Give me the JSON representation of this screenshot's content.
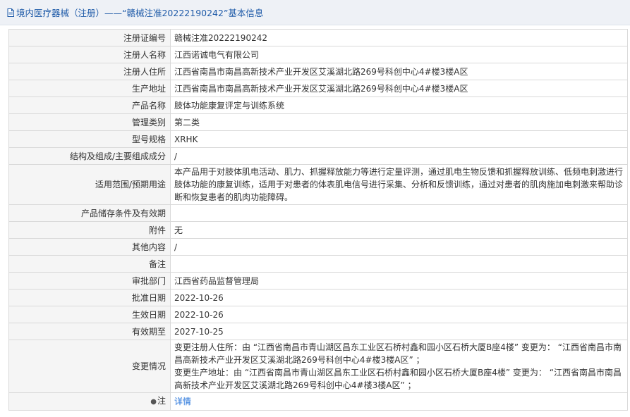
{
  "header": {
    "icon": "document-icon",
    "title": "境内医疗器械（注册）——“赣械注准20222190242”基本信息"
  },
  "rows": [
    {
      "label": "注册证编号",
      "value": "赣械注准20222190242"
    },
    {
      "label": "注册人名称",
      "value": "江西诺诚电气有限公司"
    },
    {
      "label": "注册人住所",
      "value": "江西省南昌市南昌高新技术产业开发区艾溪湖北路269号科创中心4#楼3楼A区"
    },
    {
      "label": "生产地址",
      "value": "江西省南昌市南昌高新技术产业开发区艾溪湖北路269号科创中心4#楼3楼A区"
    },
    {
      "label": "产品名称",
      "value": "肢体功能康复评定与训练系统"
    },
    {
      "label": "管理类别",
      "value": "第二类"
    },
    {
      "label": "型号规格",
      "value": "XRHK"
    },
    {
      "label": "结构及组成/主要组成成分",
      "value": "/"
    },
    {
      "label": "适用范围/预期用途",
      "value": "本产品用于对肢体肌电活动、肌力、抓握释放能力等进行定量评测，通过肌电生物反馈和抓握释放训练、低频电刺激进行肢体功能的康复训练，适用于对患者的体表肌电信号进行采集、分析和反馈训练，通过对患者的肌肉施加电刺激来帮助诊断和恢复患者的肌肉功能障碍。"
    },
    {
      "label": "产品储存条件及有效期",
      "value": ""
    },
    {
      "label": "附件",
      "value": "无"
    },
    {
      "label": "其他内容",
      "value": "/"
    },
    {
      "label": "备注",
      "value": ""
    },
    {
      "label": "审批部门",
      "value": "江西省药品监督管理局"
    },
    {
      "label": "批准日期",
      "value": "2022-10-26"
    },
    {
      "label": "生效日期",
      "value": "2022-10-26"
    },
    {
      "label": "有效期至",
      "value": "2027-10-25"
    },
    {
      "label": "变更情况",
      "value": "变更注册人住所：由 “江西省南昌市青山湖区昌东工业区石桥村鑫和园小区石桥大厦B座4楼” 变更为： “江西省南昌市南昌高新技术产业开发区艾溪湖北路269号科创中心4#楼3楼A区” ；\n变更生产地址：由 “江西省南昌市青山湖区昌东工业区石桥村鑫和园小区石桥大厦B座4楼” 变更为： “江西省南昌市南昌高新技术产业开发区艾溪湖北路269号科创中心4#楼3楼A区” ；"
    }
  ],
  "note": {
    "icon": "lightbulb-icon",
    "label": "注",
    "link_text": "详情"
  }
}
